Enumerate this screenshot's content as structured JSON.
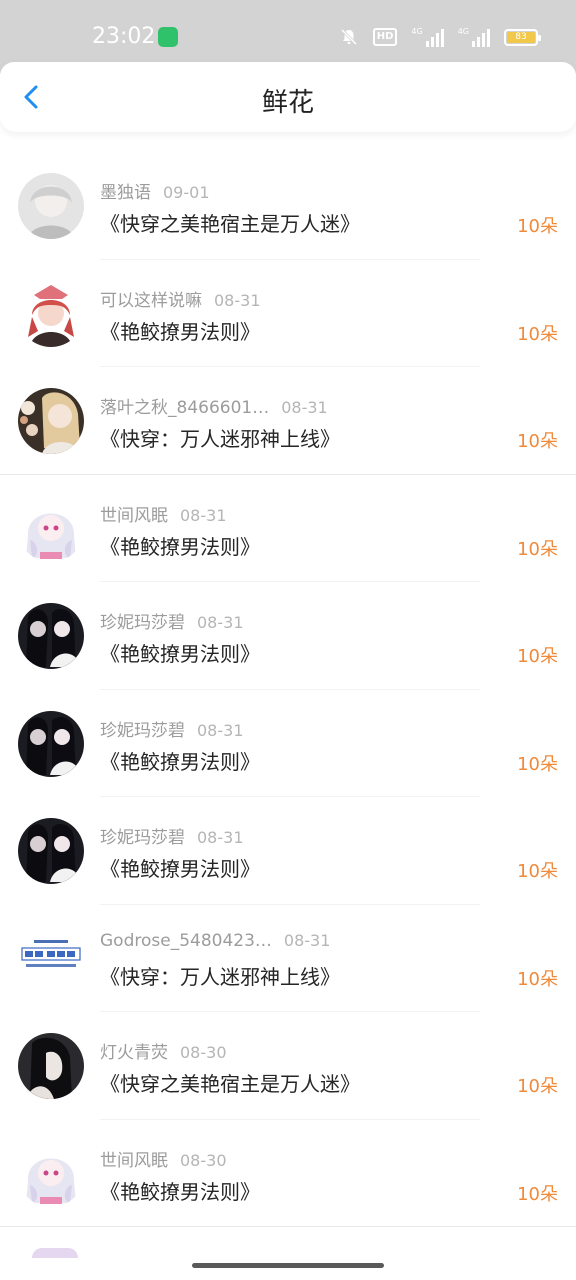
{
  "status_bar": {
    "time": "23:02",
    "hd_label": "HD",
    "signal_label": "4G",
    "battery": "83"
  },
  "header": {
    "title": "鲜花"
  },
  "records": [
    {
      "name": "墨独语",
      "date": "09-01",
      "book": "《快穿之美艳宿主是万人迷》",
      "amount": "10朵"
    },
    {
      "name": "可以这样说嘛",
      "date": "08-31",
      "book": "《艳鲛撩男法则》",
      "amount": "10朵"
    },
    {
      "name": "落叶之秋_8466601…",
      "date": "08-31",
      "book": "《快穿：万人迷邪神上线》",
      "amount": "10朵"
    },
    {
      "name": "世间风眠",
      "date": "08-31",
      "book": "《艳鲛撩男法则》",
      "amount": "10朵"
    },
    {
      "name": "珍妮玛莎碧",
      "date": "08-31",
      "book": "《艳鲛撩男法则》",
      "amount": "10朵"
    },
    {
      "name": "珍妮玛莎碧",
      "date": "08-31",
      "book": "《艳鲛撩男法则》",
      "amount": "10朵"
    },
    {
      "name": "珍妮玛莎碧",
      "date": "08-31",
      "book": "《艳鲛撩男法则》",
      "amount": "10朵"
    },
    {
      "name": "Godrose_5480423…",
      "date": "08-31",
      "book": "《快穿：万人迷邪神上线》",
      "amount": "10朵"
    },
    {
      "name": "灯火青荧",
      "date": "08-30",
      "book": "《快穿之美艳宿主是万人迷》",
      "amount": "10朵"
    },
    {
      "name": "世间风眠",
      "date": "08-30",
      "book": "《艳鲛撩男法则》",
      "amount": "10朵"
    }
  ],
  "colors": {
    "accent": "#1e8ef0",
    "amount": "#f08a3b",
    "status_bar": "#d3d3d3"
  }
}
